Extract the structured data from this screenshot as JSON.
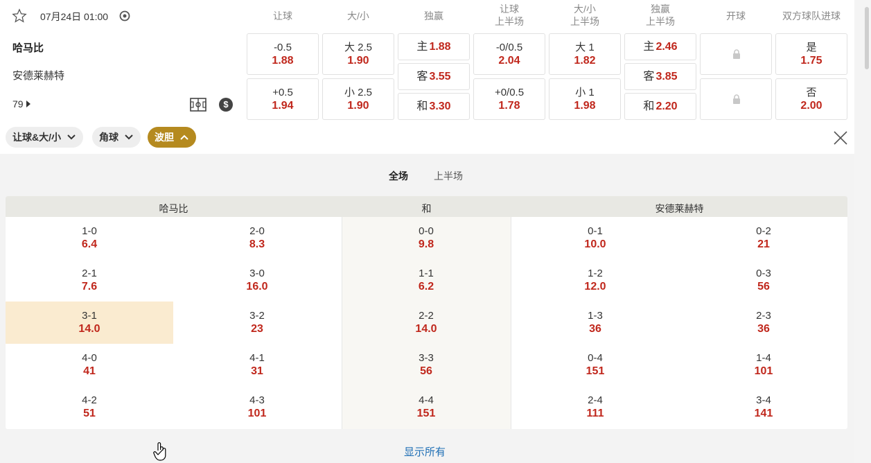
{
  "match": {
    "datetime": "07月24日 01:00",
    "home_team": "哈马比",
    "away_team": "安德莱赫特",
    "more_markets": "79"
  },
  "columns": [
    {
      "line1": "让球",
      "line2": ""
    },
    {
      "line1": "大/小",
      "line2": ""
    },
    {
      "line1": "独赢",
      "line2": ""
    },
    {
      "line1": "让球",
      "line2": "上半场"
    },
    {
      "line1": "大/小",
      "line2": "上半场"
    },
    {
      "line1": "独赢",
      "line2": "上半场"
    },
    {
      "line1": "开球",
      "line2": ""
    },
    {
      "line1": "双方球队进球",
      "line2": ""
    }
  ],
  "odds": {
    "handicap": [
      {
        "label": "-0.5",
        "value": "1.88"
      },
      {
        "label": "+0.5",
        "value": "1.94"
      }
    ],
    "over_under": [
      {
        "label": "大 2.5",
        "value": "1.90"
      },
      {
        "label": "小 2.5",
        "value": "1.90"
      }
    ],
    "moneyline": [
      {
        "label": "主",
        "value": "1.88"
      },
      {
        "label": "客",
        "value": "3.55"
      },
      {
        "label": "和",
        "value": "3.30"
      }
    ],
    "ht_handicap": [
      {
        "label": "-0/0.5",
        "value": "2.04"
      },
      {
        "label": "+0/0.5",
        "value": "1.78"
      }
    ],
    "ht_over_under": [
      {
        "label": "大 1",
        "value": "1.82"
      },
      {
        "label": "小 1",
        "value": "1.98"
      }
    ],
    "ht_moneyline": [
      {
        "label": "主",
        "value": "2.46"
      },
      {
        "label": "客",
        "value": "3.85"
      },
      {
        "label": "和",
        "value": "2.20"
      }
    ],
    "btts": [
      {
        "label": "是",
        "value": "1.75"
      },
      {
        "label": "否",
        "value": "2.00"
      }
    ]
  },
  "filters": [
    {
      "label": "让球&大/小",
      "active": false
    },
    {
      "label": "角球",
      "active": false
    },
    {
      "label": "波胆",
      "active": true
    }
  ],
  "tabs": [
    "全场",
    "上半场"
  ],
  "correct_score": {
    "headers": {
      "home": "哈马比",
      "draw": "和",
      "away": "安德莱赫特"
    },
    "home": [
      [
        {
          "score": "1-0",
          "odds": "6.4"
        },
        {
          "score": "2-0",
          "odds": "8.3"
        }
      ],
      [
        {
          "score": "2-1",
          "odds": "7.6"
        },
        {
          "score": "3-0",
          "odds": "16.0"
        }
      ],
      [
        {
          "score": "3-1",
          "odds": "14.0"
        },
        {
          "score": "3-2",
          "odds": "23"
        }
      ],
      [
        {
          "score": "4-0",
          "odds": "41"
        },
        {
          "score": "4-1",
          "odds": "31"
        }
      ],
      [
        {
          "score": "4-2",
          "odds": "51"
        },
        {
          "score": "4-3",
          "odds": "101"
        }
      ]
    ],
    "draw": [
      {
        "score": "0-0",
        "odds": "9.8"
      },
      {
        "score": "1-1",
        "odds": "6.2"
      },
      {
        "score": "2-2",
        "odds": "14.0"
      },
      {
        "score": "3-3",
        "odds": "56"
      },
      {
        "score": "4-4",
        "odds": "151"
      }
    ],
    "away": [
      [
        {
          "score": "0-1",
          "odds": "10.0"
        },
        {
          "score": "0-2",
          "odds": "21"
        }
      ],
      [
        {
          "score": "1-2",
          "odds": "12.0"
        },
        {
          "score": "0-3",
          "odds": "56"
        }
      ],
      [
        {
          "score": "1-3",
          "odds": "36"
        },
        {
          "score": "2-3",
          "odds": "36"
        }
      ],
      [
        {
          "score": "0-4",
          "odds": "151"
        },
        {
          "score": "1-4",
          "odds": "101"
        }
      ],
      [
        {
          "score": "2-4",
          "odds": "111"
        },
        {
          "score": "3-4",
          "odds": "141"
        }
      ]
    ],
    "show_all": "显示所有"
  },
  "colors": {
    "odds_red": "#c0271c",
    "active_pill": "#b58a1f",
    "highlight": "#faebd0",
    "link": "#1f6fb5"
  }
}
